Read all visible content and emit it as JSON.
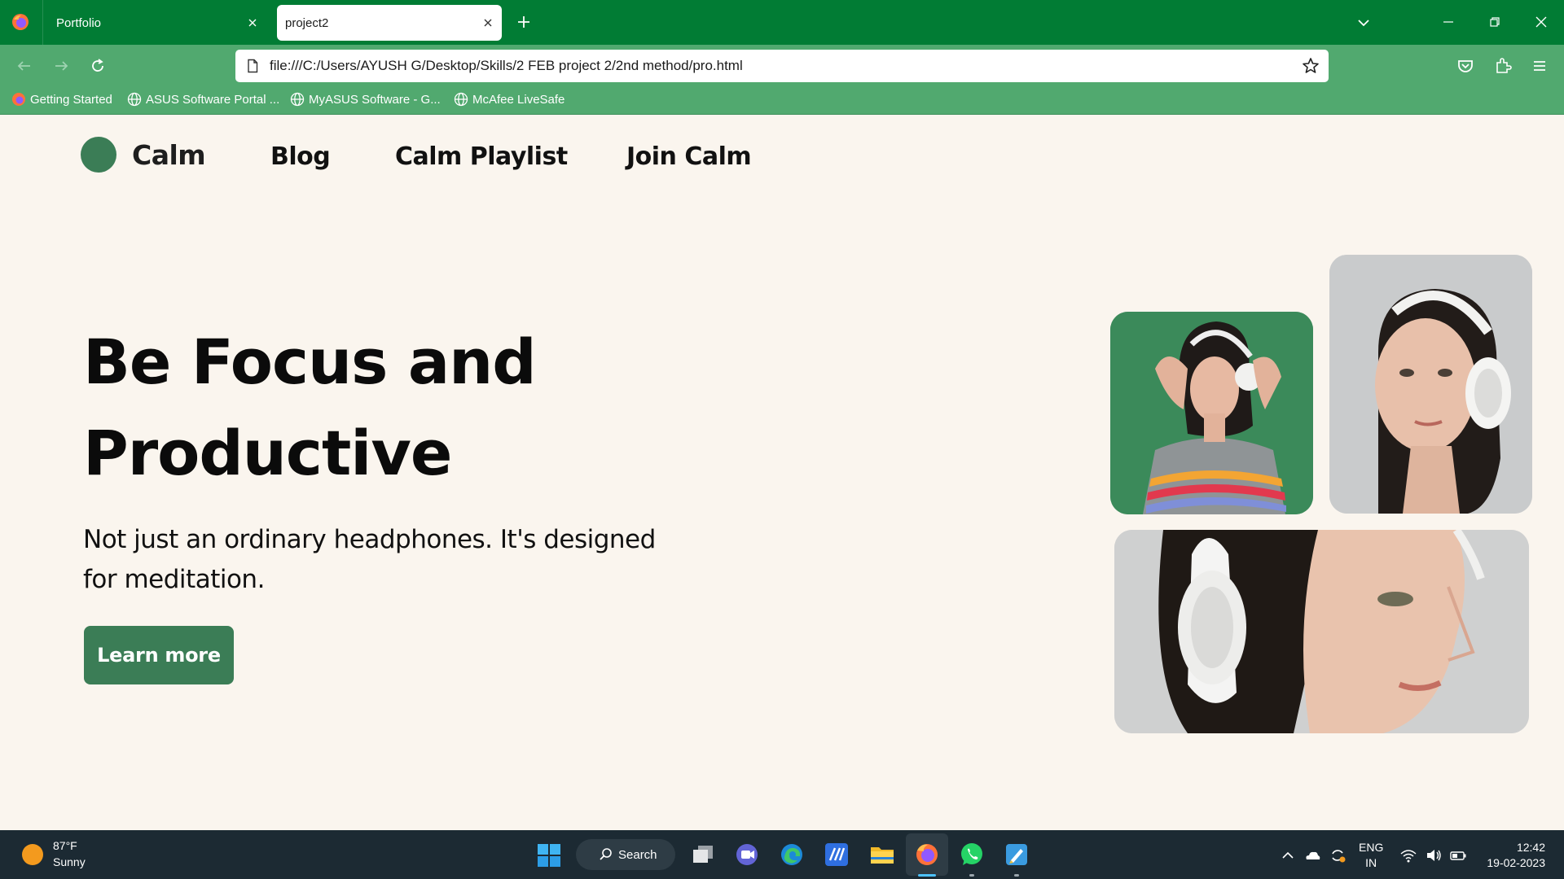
{
  "browser": {
    "tabs": [
      {
        "label": "Portfolio",
        "active": false
      },
      {
        "label": "project2",
        "active": true
      }
    ],
    "url": "file:///C:/Users/AYUSH G/Desktop/Skills/2 FEB project 2/2nd method/pro.html",
    "bookmarks": [
      {
        "label": "Getting Started",
        "icon": "firefox-icon"
      },
      {
        "label": "ASUS Software Portal ...",
        "icon": "globe-icon"
      },
      {
        "label": "MyASUS Software - G...",
        "icon": "globe-icon"
      },
      {
        "label": "McAfee LiveSafe",
        "icon": "globe-icon"
      }
    ],
    "colors": {
      "tabbar": "#017c34",
      "toolbar": "#51a96f"
    }
  },
  "site": {
    "logo_text": "Calm",
    "nav": [
      "Blog",
      "Calm Playlist",
      "Join Calm"
    ],
    "hero": {
      "title_line1": "Be Focus and",
      "title_line2": "Productive",
      "subtitle": "Not just an ordinary headphones. It's designed for meditation.",
      "cta": "Learn more"
    },
    "photos": [
      {
        "icon": "woman-headphones-green-photo"
      },
      {
        "icon": "woman-headphones-portrait-photo"
      },
      {
        "icon": "woman-headphones-closeup-photo"
      }
    ],
    "colors": {
      "accent": "#3b7d56",
      "background": "#faf5ee"
    }
  },
  "taskbar": {
    "weather": {
      "temp": "87°F",
      "condition": "Sunny"
    },
    "search_label": "Search",
    "apps": [
      "task-view-icon",
      "teams-icon",
      "edge-icon",
      "vs-code-icon",
      "file-explorer-icon",
      "firefox-icon",
      "whatsapp-icon",
      "paint-icon"
    ],
    "lang_line1": "ENG",
    "lang_line2": "IN",
    "time": "12:42",
    "date": "19-02-2023"
  }
}
